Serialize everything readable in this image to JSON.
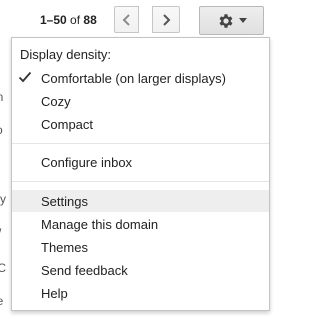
{
  "pager": {
    "range": "1–50",
    "of_word": "of",
    "total": "88"
  },
  "icons": {
    "prev": "chevron-left-icon",
    "next": "chevron-right-icon",
    "settings": "gear-icon",
    "dropdown": "caret-down-icon",
    "selected": "check-icon"
  },
  "menu": {
    "density_header": "Display density:",
    "density_options": [
      {
        "label": "Comfortable (on larger displays)",
        "selected": true
      },
      {
        "label": "Cozy",
        "selected": false
      },
      {
        "label": "Compact",
        "selected": false
      }
    ],
    "configure_inbox": "Configure inbox",
    "items": [
      {
        "label": "Settings",
        "highlighted": true
      },
      {
        "label": "Manage this domain",
        "highlighted": false
      },
      {
        "label": "Themes",
        "highlighted": false
      },
      {
        "label": "Send feedback",
        "highlighted": false
      },
      {
        "label": "Help",
        "highlighted": false
      }
    ]
  },
  "background_snippets": [
    "n",
    "on",
    "so",
    "rd",
    "e y",
    "W",
    "r C",
    "ge"
  ]
}
